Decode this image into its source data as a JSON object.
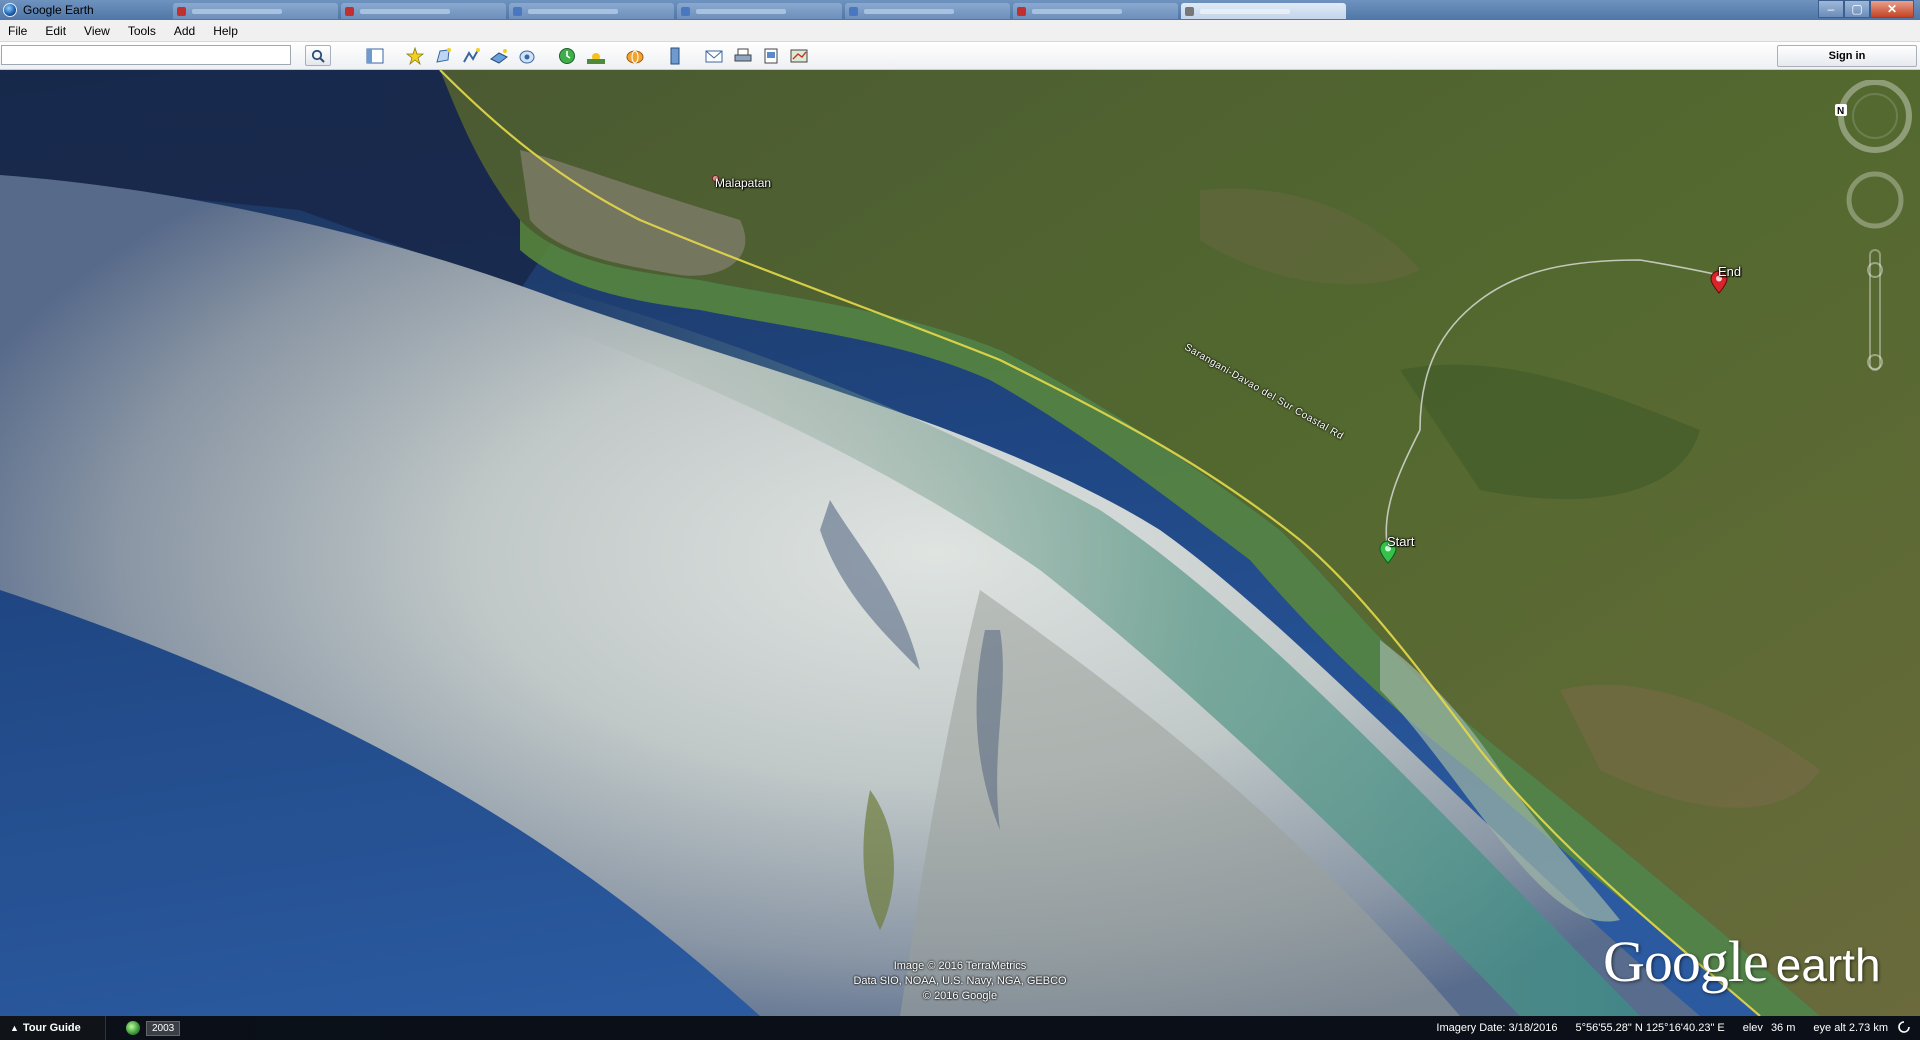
{
  "window": {
    "title": "Google Earth",
    "controls": {
      "minimize": "–",
      "maximize": "▢",
      "close": "✕"
    }
  },
  "menu": {
    "items": [
      "File",
      "Edit",
      "View",
      "Tools",
      "Add",
      "Help"
    ]
  },
  "toolbar": {
    "search_value": "",
    "sign_in_label": "Sign in",
    "buttons": [
      "sidebar-toggle-icon",
      "add-placemark-icon",
      "add-polygon-icon",
      "add-path-icon",
      "add-image-overlay-icon",
      "record-tour-icon",
      "historical-imagery-icon",
      "sunlight-icon",
      "switch-to-sky-icon",
      "ruler-icon",
      "email-icon",
      "print-icon",
      "save-image-icon",
      "view-in-maps-icon"
    ]
  },
  "map": {
    "place_label": "Malapatan",
    "road_label": "Sarangani-Davao del Sur Coastal Rd",
    "start_label": "Start",
    "end_label": "End",
    "credits": [
      "Image © 2016 TerraMetrics",
      "Data SIO, NOAA, U.S. Navy, NGA, GEBCO",
      "© 2016 Google"
    ],
    "logo": {
      "google": "Google",
      "earth": "earth"
    },
    "colors": {
      "start_pin": "#35c24a",
      "end_pin": "#d8242a",
      "road": "#e5d94a",
      "path": "#e8e8e8"
    }
  },
  "status": {
    "tour_guide_label": "Tour Guide",
    "year": "2003",
    "imagery_date": "Imagery Date: 3/18/2016",
    "coordinates": "5°56'55.28\" N  125°16'40.23\" E",
    "elev_label": "elev",
    "elev_value": "36 m",
    "eye_alt": "eye alt  2.73 km"
  }
}
